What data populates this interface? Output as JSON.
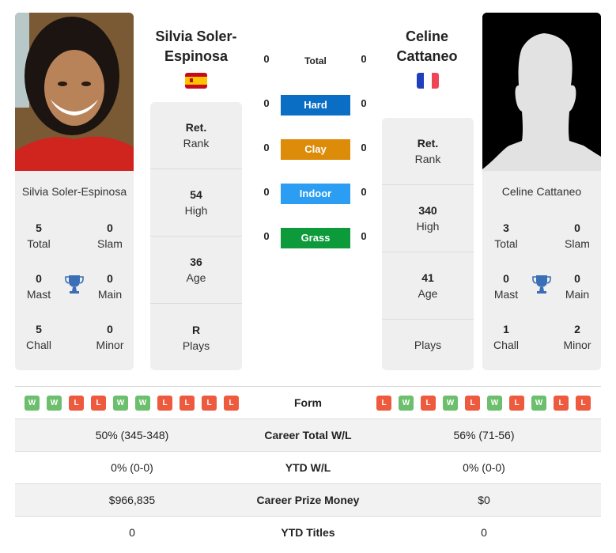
{
  "player1": {
    "name_heading_line1": "Silvia Soler-",
    "name_heading_line2": "Espinosa",
    "card_name": "Silvia Soler-Espinosa",
    "country": "Spain",
    "flag_colors": [
      "#c60b1e",
      "#ffc400",
      "#c60b1e"
    ],
    "titles": {
      "total": "5",
      "total_label": "Total",
      "slam": "0",
      "slam_label": "Slam",
      "mast": "0",
      "mast_label": "Mast",
      "main": "0",
      "main_label": "Main",
      "chall": "5",
      "chall_label": "Chall",
      "minor": "0",
      "minor_label": "Minor"
    },
    "rank": {
      "value": "Ret.",
      "label": "Rank"
    },
    "high": {
      "value": "54",
      "label": "High"
    },
    "age": {
      "value": "36",
      "label": "Age"
    },
    "plays": {
      "value": "R",
      "label": "Plays"
    },
    "form": [
      "W",
      "W",
      "L",
      "L",
      "W",
      "W",
      "L",
      "L",
      "L",
      "L"
    ]
  },
  "player2": {
    "name_heading_line1": "Celine",
    "name_heading_line2": "Cattaneo",
    "card_name": "Celine Cattaneo",
    "country": "France",
    "flag_colors": [
      "#1f3fbf",
      "#ffffff",
      "#ef4656"
    ],
    "titles": {
      "total": "3",
      "total_label": "Total",
      "slam": "0",
      "slam_label": "Slam",
      "mast": "0",
      "mast_label": "Mast",
      "main": "0",
      "main_label": "Main",
      "chall": "1",
      "chall_label": "Chall",
      "minor": "2",
      "minor_label": "Minor"
    },
    "rank": {
      "value": "Ret.",
      "label": "Rank"
    },
    "high": {
      "value": "340",
      "label": "High"
    },
    "age": {
      "value": "41",
      "label": "Age"
    },
    "plays": {
      "value": "",
      "label": "Plays"
    },
    "form": [
      "L",
      "W",
      "L",
      "W",
      "L",
      "W",
      "L",
      "W",
      "L",
      "L"
    ]
  },
  "surfaces": [
    {
      "label": "Total",
      "left": "0",
      "right": "0",
      "color": ""
    },
    {
      "label": "Hard",
      "left": "0",
      "right": "0",
      "color": "#0a6ec4"
    },
    {
      "label": "Clay",
      "left": "0",
      "right": "0",
      "color": "#dd8c0a"
    },
    {
      "label": "Indoor",
      "left": "0",
      "right": "0",
      "color": "#2b9df2"
    },
    {
      "label": "Grass",
      "left": "0",
      "right": "0",
      "color": "#0c9a3a"
    }
  ],
  "stats": {
    "form_label": "Form",
    "rows": [
      {
        "label": "Career Total W/L",
        "left": "50% (345-348)",
        "right": "56% (71-56)"
      },
      {
        "label": "YTD W/L",
        "left": "0% (0-0)",
        "right": "0% (0-0)"
      },
      {
        "label": "Career Prize Money",
        "left": "$966,835",
        "right": "$0"
      },
      {
        "label": "YTD Titles",
        "left": "0",
        "right": "0"
      }
    ]
  },
  "colors": {
    "win": "#6cbf6c",
    "loss": "#ee5a3e",
    "trophy": "#3a6fb7",
    "card_bg": "#efefef"
  }
}
